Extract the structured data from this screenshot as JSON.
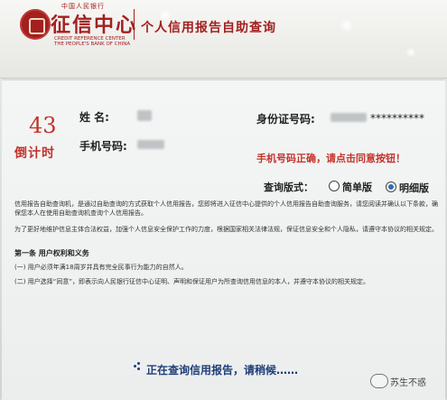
{
  "header": {
    "logo_top": "中国人民银行",
    "logo_main": "征信中心",
    "logo_en": "CREDIT REFERENCE CENTER THE PEOPLE'S BANK OF CHINA",
    "title": "个人信用报告自助查询"
  },
  "countdown": {
    "value": "43",
    "label": "倒计时"
  },
  "form": {
    "name_label": "姓    名:",
    "phone_label": "手机号码:",
    "id_label": "身份证号码:",
    "id_masked": "**********",
    "phone_message": "手机号码正确，请点击同意按钮！"
  },
  "version": {
    "label": "查询版式：",
    "options": [
      "简单版",
      "明细版"
    ],
    "selected": "明细版"
  },
  "agreement": {
    "para1": "信用报告自助查询机，是通过自助查询的方式获取个人信用报告，您即将进入征信中心提供的个人信用报告自助查询服务，请您阅读并确认以下条款，确保您本人在使用自助查询机查询个人信用报告。",
    "para2": "为了更好地维护信息主体合法权益，加强个人信息安全保护工作的力度，根据国家相关法律法规，保证信息安全和个人隐私，请遵守本协议的相关规定。",
    "section1_title": "第一条  用户权利和义务",
    "item1": "(一) 用户必须年满18周岁并具有完全民事行为能力的自然人。",
    "item2": "(二) 用户选择“同意”，即表示向人民银行征信中心证明、声明和保证用户为所查询信用信息的本人，并遵守本协议的相关规定。"
  },
  "status": {
    "loading_text": "正在查询信用报告，请稍候……"
  },
  "watermark": {
    "text": "苏生不惑"
  }
}
